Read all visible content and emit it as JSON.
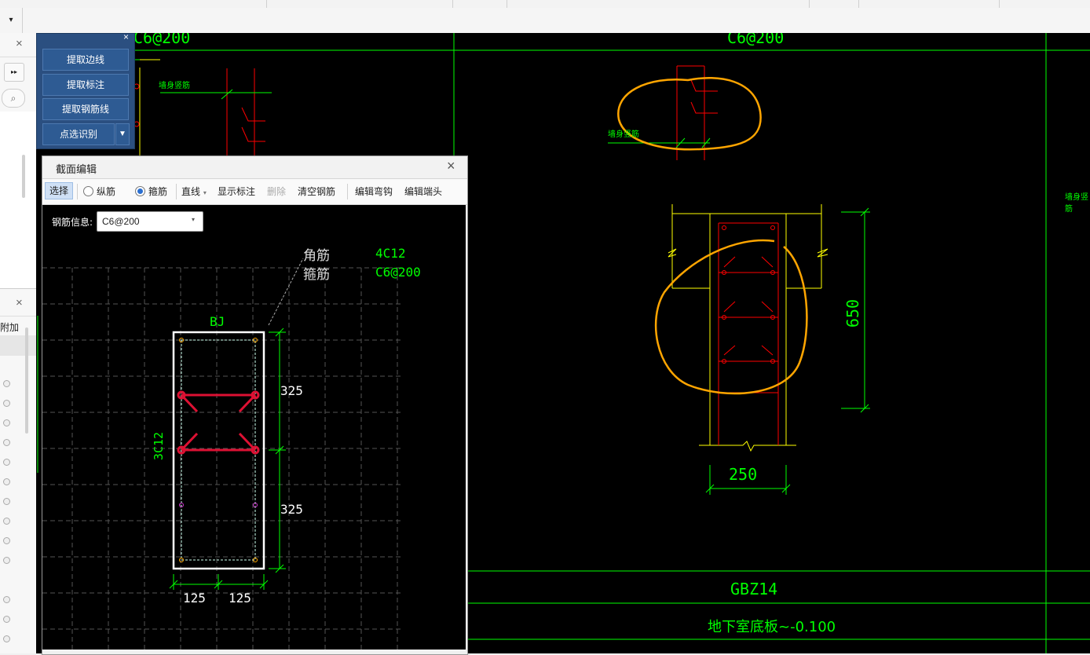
{
  "toolbox": {
    "buttons": [
      "提取边线",
      "提取标注",
      "提取钢筋线",
      "点选识别"
    ],
    "close_glyph": "×"
  },
  "left_panel": {
    "close_glyph": "×",
    "close2_glyph": "×",
    "expand_glyph": "▸▸",
    "search_glyph": "⌕",
    "attach_label": "附加"
  },
  "toolbar2": {
    "dropdown_glyph": "▾"
  },
  "dialog": {
    "title": "截面编辑",
    "close_glyph": "×",
    "tools": {
      "select": "选择",
      "longitudinal": "纵筋",
      "stirrup": "箍筋",
      "line": "直线",
      "line_arrow": "▾",
      "show_dims": "显示标注",
      "delete": "删除",
      "clear_rebar": "清空钢筋",
      "edit_hook": "编辑弯钩",
      "edit_end": "编辑端头"
    },
    "rebar_info_label": "钢筋信息:",
    "rebar_info_value": "C6@200",
    "rebar_info_arrow": "▾",
    "legend": {
      "corner_label": "角筋",
      "stirrup_label": "箍筋",
      "corner_value": "4C12",
      "stirrup_value": "C6@200"
    },
    "section_name": "BJ",
    "side_bars": "3C12",
    "dims": {
      "top": "325",
      "bottom": "325",
      "width_left": "125",
      "width_right": "125"
    }
  },
  "drawing": {
    "top_label_left": "C6@200",
    "top_label_center": "C6@200",
    "dim_height": "650",
    "dim_width": "250",
    "section_id": "GBZ14",
    "elevation": "地下室底板~-0.100",
    "small_label_left": "墙身竖筋",
    "small_label_mid": "墙身竖筋",
    "small_label_right": "墙身竖筋",
    "colors": {
      "green": "#00ff00",
      "red": "#ff0000",
      "yellow": "#ffff00",
      "orange": "#ffa500",
      "white": "#ffffff",
      "stirrup_red": "#dd1133"
    }
  }
}
